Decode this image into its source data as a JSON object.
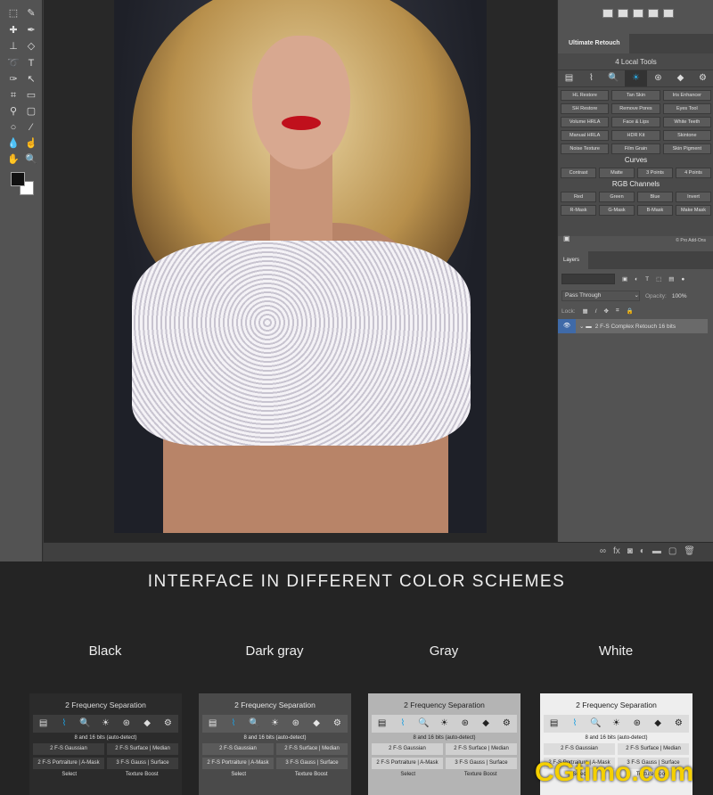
{
  "panel": {
    "tab": "Ultimate Retouch",
    "title": "4 Local Tools",
    "icons": [
      "document-icon",
      "pulse-icon",
      "magnifier-icon",
      "contrast-icon",
      "channels-icon",
      "diamond-icon",
      "gear-icon"
    ],
    "active_icon": 3,
    "tools": [
      "HL Restore",
      "Tan Skin",
      "Iris Enhancer",
      "SH Restore",
      "Remove Pores",
      "Eyes Tool",
      "Volume HRLA",
      "Face & Lips",
      "White Teeth",
      "Manual HRLA",
      "HDR Kit",
      "Skintone",
      "Noise Texture",
      "Film Grain",
      "Skin Pigment"
    ],
    "curves_label": "Curves",
    "curves": [
      "Contrast",
      "Matte",
      "3 Points",
      "4 Points"
    ],
    "rgb_label": "RGB Channels",
    "rgb": [
      "Red",
      "Green",
      "Blue",
      "Invert",
      "R-Mask",
      "G-Mask",
      "B-Mask",
      "Make Mask"
    ],
    "credit": "© Pro Add-Ons"
  },
  "layers": {
    "tab": "Layers",
    "blend_mode": "Pass Through",
    "opacity_label": "Opacity:",
    "opacity": "100%",
    "lock_label": "Lock:",
    "layer_name": "2 F-S Complex Retouch 16 bits"
  },
  "section": {
    "heading": "INTERFACE IN DIFFERENT COLOR SCHEMES",
    "schemes": [
      {
        "label": "Black",
        "bg": "#2b2b2b",
        "btn": "#3c3c3c",
        "fg": "#dddddd"
      },
      {
        "label": "Dark gray",
        "bg": "#4a4a4a",
        "btn": "#5a5a5a",
        "fg": "#e6e6e6"
      },
      {
        "label": "Gray",
        "bg": "#b4b4b4",
        "btn": "#cfcfcf",
        "fg": "#222222"
      },
      {
        "label": "White",
        "bg": "#eeeeee",
        "btn": "#dcdcdc",
        "fg": "#222222"
      }
    ],
    "panel_title": "2 Frequency Separation",
    "bits": "8 and 16 bits (auto-detect)",
    "buttons": [
      "2 F-S Gaussian",
      "2 F-S Surface | Median",
      "2 F-S Portraiture | A-Mask",
      "3 F-S Gauss | Surface"
    ],
    "select_label": "Select",
    "texture_label": "Texture Boost"
  },
  "watermark": "CGtimo.com",
  "colors": {
    "accent": "#2aa8e0",
    "watermark": "#f5d000"
  }
}
